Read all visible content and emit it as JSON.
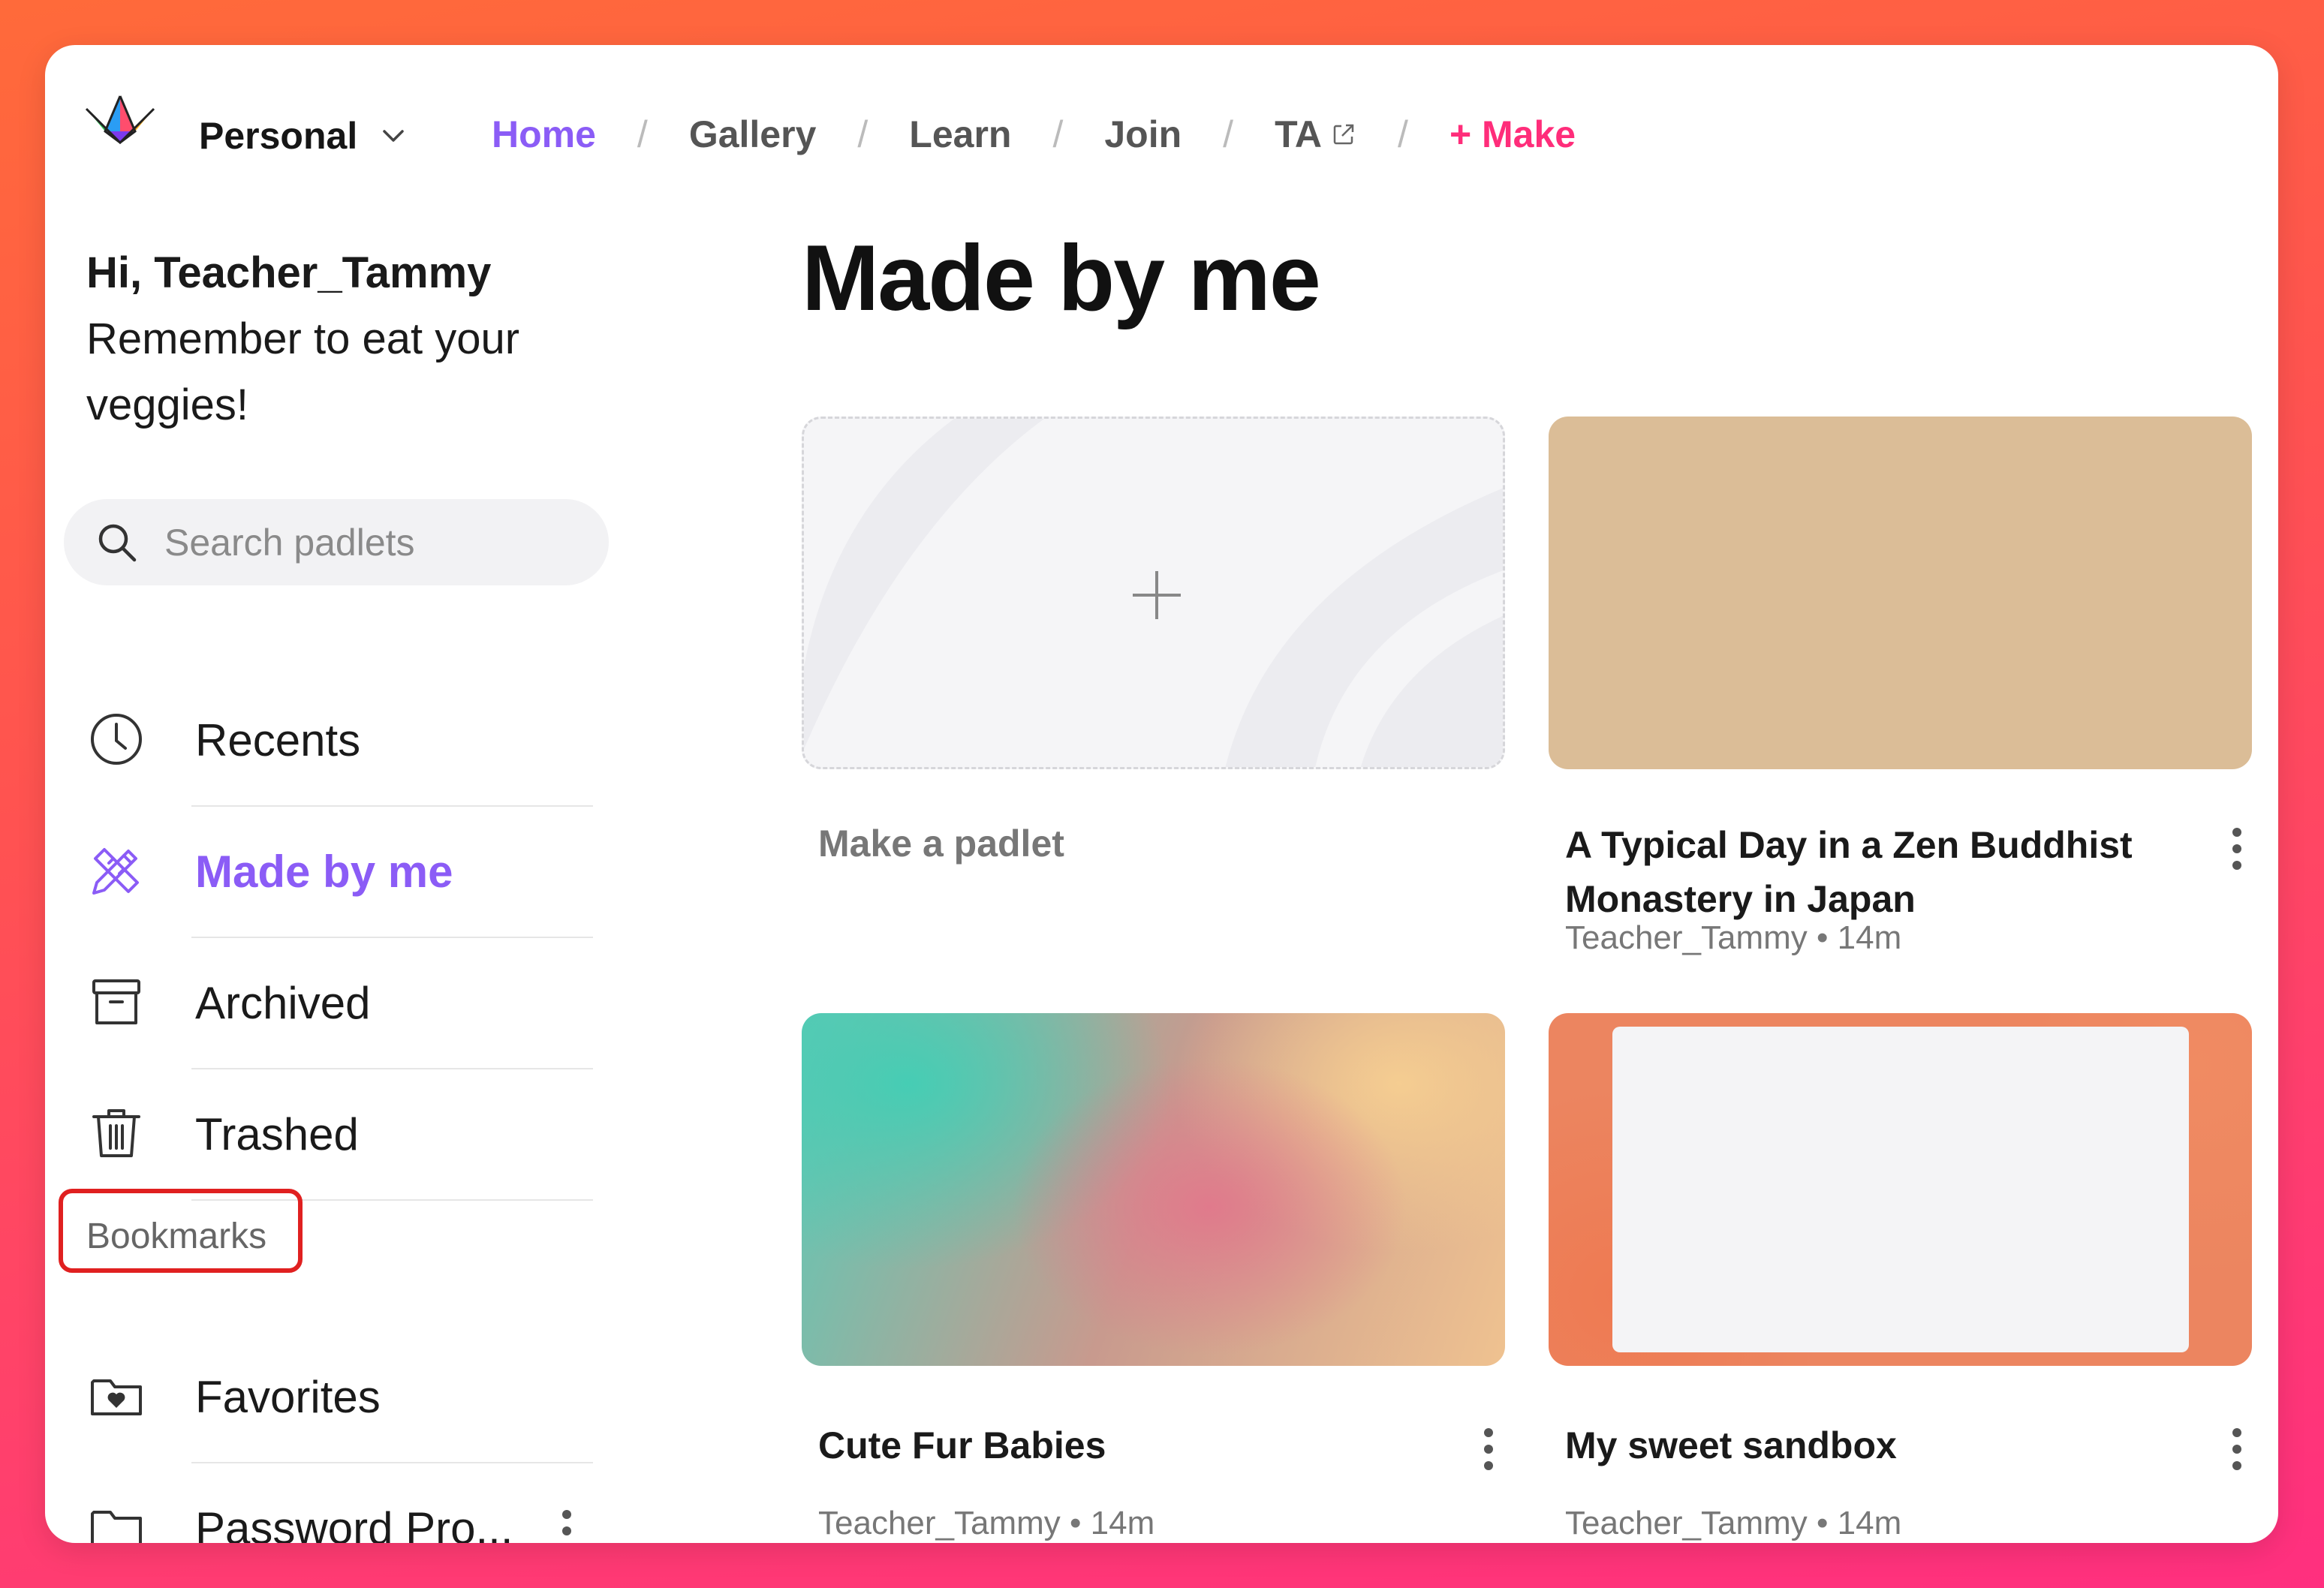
{
  "workspace": {
    "label": "Personal"
  },
  "nav": {
    "home": "Home",
    "gallery": "Gallery",
    "learn": "Learn",
    "join": "Join",
    "ta": "TA",
    "make": "+ Make",
    "separator": "/"
  },
  "greeting": {
    "hi": "Hi, Teacher_Tammy",
    "message": "Remember to eat your veggies!"
  },
  "search": {
    "placeholder": "Search padlets"
  },
  "sidebar": {
    "items": [
      {
        "label": "Recents",
        "icon": "clock-icon"
      },
      {
        "label": "Made by me",
        "icon": "pencil-ruler-icon",
        "active": true
      },
      {
        "label": "Archived",
        "icon": "archive-box-icon"
      },
      {
        "label": "Trashed",
        "icon": "trash-icon"
      }
    ],
    "bookmarks_label": "Bookmarks",
    "bookmarks": [
      {
        "label": "Favorites",
        "icon": "folder-heart-icon"
      },
      {
        "label": "Password Pro...",
        "icon": "folder-icon"
      }
    ]
  },
  "main": {
    "title": "Made by me",
    "make_label": "Make a padlet",
    "cards": [
      {
        "title": "A Typical Day in a Zen Buddhist Monastery in Japan",
        "author": "Teacher_Tammy",
        "time": "14m",
        "dot": "•"
      },
      {
        "title": "Cute Fur Babies",
        "author": "Teacher_Tammy",
        "time": "14m",
        "dot": "•"
      },
      {
        "title": "My sweet sandbox",
        "author": "Teacher_Tammy",
        "time": "14m",
        "dot": "•"
      }
    ]
  },
  "colors": {
    "accent": "#8b5cf6",
    "make": "#ff2d7a",
    "highlight_box": "#e02020"
  }
}
